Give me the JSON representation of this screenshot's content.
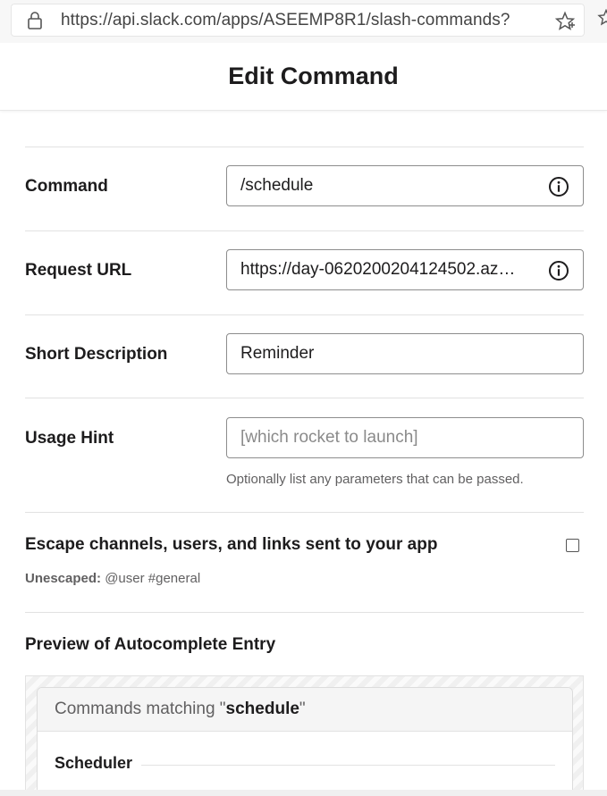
{
  "browser": {
    "url": "https://api.slack.com/apps/ASEEMP8R1/slash-commands?"
  },
  "page": {
    "title": "Edit Command"
  },
  "form": {
    "command": {
      "label": "Command",
      "value": "/schedule"
    },
    "request_url": {
      "label": "Request URL",
      "value": "https://day-0620200204124502.az…"
    },
    "short_description": {
      "label": "Short Description",
      "value": "Reminder"
    },
    "usage_hint": {
      "label": "Usage Hint",
      "placeholder": "[which rocket to launch]",
      "help": "Optionally list any parameters that can be passed."
    },
    "escape": {
      "label": "Escape channels, users, and links sent to your app",
      "checked": false,
      "note_label": "Unescaped:",
      "note_value": "@user #general"
    }
  },
  "preview": {
    "heading": "Preview of Autocomplete Entry",
    "matching_prefix": "Commands matching \"",
    "matching_term": "schedule",
    "matching_suffix": "\"",
    "section": "Scheduler"
  }
}
